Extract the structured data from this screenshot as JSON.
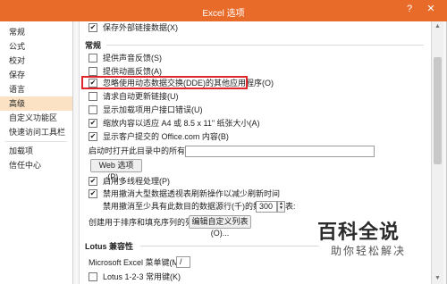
{
  "window": {
    "title": "Excel 选项",
    "help_icon": "?",
    "close_icon": "✕"
  },
  "sidebar": {
    "items": [
      {
        "label": "常规"
      },
      {
        "label": "公式"
      },
      {
        "label": "校对"
      },
      {
        "label": "保存"
      },
      {
        "label": "语言"
      },
      {
        "label": "高级"
      },
      {
        "label": "自定义功能区"
      },
      {
        "label": "快速访问工具栏"
      },
      {
        "label": "加载项"
      },
      {
        "label": "信任中心"
      }
    ]
  },
  "content": {
    "top_option": {
      "label": "保存外部链接数据(X)",
      "checked": true
    },
    "section_general": "常规",
    "options": [
      {
        "label": "提供声音反馈(S)",
        "checked": false
      },
      {
        "label": "提供动画反馈(A)",
        "checked": false
      },
      {
        "label": "忽略使用动态数据交换(DDE)的其他应用程序(O)",
        "checked": true
      },
      {
        "label": "请求自动更新链接(U)",
        "checked": false
      },
      {
        "label": "显示加载项用户接口错误(U)",
        "checked": false
      },
      {
        "label": "缩放内容以适应 A4 或 8.5 x 11\" 纸张大小(A)",
        "checked": true
      },
      {
        "label": "显示客户提交的 Office.com 内容(B)",
        "checked": true
      }
    ],
    "startup_label": "启动时打开此目录中的所有文件(L):",
    "startup_value": "",
    "web_options_button": "Web 选项(P)...",
    "multithread": {
      "label": "启用多线程处理(P)",
      "checked": true
    },
    "pivot_disable": {
      "label": "禁用撤消大型数据透视表刷新操作以减少刷新时间",
      "checked": true
    },
    "pivot_rows_label": "禁用撤消至少具有此数目的数据源行(千)的数据透视表:",
    "pivot_rows_value": "300",
    "spin_up": "▲",
    "spin_down": "▼",
    "custom_list_label": "创建用于排序和填充序列的列表:",
    "custom_list_button": "编辑自定义列表(O)...",
    "section_lotus": "Lotus 兼容性",
    "menu_key_label": "Microsoft Excel 菜单键(M):",
    "menu_key_value": "/",
    "lotus_nav": {
      "label": "Lotus 1-2-3 常用键(K)",
      "checked": false
    }
  },
  "scrollbar": {
    "up_icon": "▲",
    "down_icon": "▼"
  },
  "watermark": {
    "main": "百科全说",
    "sub": "助你轻松解决"
  },
  "colors": {
    "titlebar": "#e96b2a",
    "highlight_border": "#e0262d",
    "active_sidebar": "#fbe2c4"
  }
}
